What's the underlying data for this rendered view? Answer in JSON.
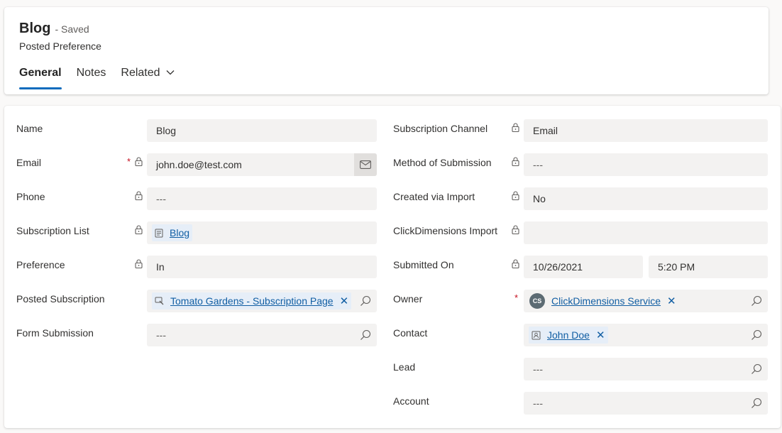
{
  "header": {
    "title": "Blog",
    "saved": "- Saved",
    "entity": "Posted Preference",
    "tabs": [
      "General",
      "Notes",
      "Related"
    ]
  },
  "left": {
    "name": {
      "label": "Name",
      "value": "Blog"
    },
    "email": {
      "label": "Email",
      "value": "john.doe@test.com"
    },
    "phone": {
      "label": "Phone",
      "value": "---"
    },
    "subscription_list": {
      "label": "Subscription List",
      "value": "Blog"
    },
    "preference": {
      "label": "Preference",
      "value": "In"
    },
    "posted_subscription": {
      "label": "Posted Subscription",
      "value": "Tomato Gardens - Subscription Page"
    },
    "form_submission": {
      "label": "Form Submission",
      "value": "---"
    }
  },
  "right": {
    "subscription_channel": {
      "label": "Subscription Channel",
      "value": "Email"
    },
    "method": {
      "label": "Method of Submission",
      "value": "---"
    },
    "created_via_import": {
      "label": "Created via Import",
      "value": "No"
    },
    "cd_import": {
      "label": "ClickDimensions Import",
      "value": ""
    },
    "submitted_on": {
      "label": "Submitted On",
      "date": "10/26/2021",
      "time": "5:20 PM"
    },
    "owner": {
      "label": "Owner",
      "initials": "CS",
      "value": "ClickDimensions Service"
    },
    "contact": {
      "label": "Contact",
      "value": "John Doe"
    },
    "lead": {
      "label": "Lead",
      "value": "---"
    },
    "account": {
      "label": "Account",
      "value": "---"
    }
  },
  "marks": {
    "required": "*",
    "remove": "✕"
  },
  "colors": {
    "accent": "#0f6cbd",
    "link": "#115ea3",
    "required": "#c50f1f"
  }
}
